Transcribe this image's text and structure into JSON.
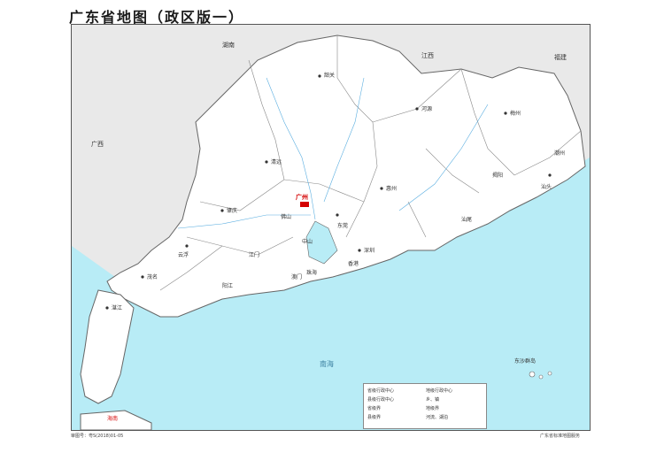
{
  "title": "广东省地图（政区版一）",
  "map": {
    "capital_label": "广州",
    "sea_label_south": "南海",
    "island_label_hainan": "海南",
    "provinces": {
      "hunan": "湖南",
      "jiangxi": "江西",
      "fujian": "福建",
      "guangxi": "广西"
    },
    "cities": [
      "韶关",
      "清远",
      "河源",
      "梅州",
      "潮州",
      "汕头",
      "揭阳",
      "汕尾",
      "惠州",
      "东莞",
      "深圳",
      "佛山",
      "肇庆",
      "云浮",
      "江门",
      "中山",
      "珠海",
      "阳江",
      "茂名",
      "湛江",
      "香港",
      "澳门"
    ],
    "islands_label": "东沙群岛",
    "colors": {
      "sea": "#b8ecf6",
      "land": "#ffffff",
      "neighbor_land": "#e9e9e9",
      "capital": "#d40000",
      "rivers": "#5aaee0"
    }
  },
  "legend": {
    "items": [
      "省级行政中心",
      "地级行政中心",
      "县级行政中心",
      "乡、镇",
      "省级界",
      "地级界",
      "县级界",
      "河流、湖泊"
    ]
  },
  "footer": {
    "left": "审图号：粤S(2018)01-05",
    "right": "广东省标准地图服务"
  }
}
